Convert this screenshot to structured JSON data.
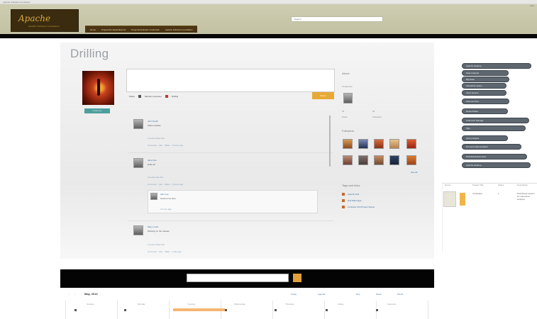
{
  "page": {
    "title": "Drilling"
  },
  "header": {
    "logo": {
      "word": "Apache",
      "sub": "Apache Software Foundation"
    },
    "search_placeholder": "Search",
    "nav": [
      "Home",
      "Projects/Incubator/Events",
      "Projects/Incubator Codes/Lab",
      "Apache Software Foundation"
    ],
    "right": "Help"
  },
  "profile": {
    "button": "Following"
  },
  "status": {
    "actions": [
      "Share",
      "Mention someone",
      "Drilling"
    ],
    "share_button": "Share"
  },
  "feed": {
    "posts": [
      {
        "name": "John Smith",
        "text": "Status update",
        "meta": "Comment · Like · Share · 3 hours ago",
        "likes": "1 person likes this"
      },
      {
        "name": "Jane Doe",
        "text": "Hello all",
        "meta": "Comment · Like · Share · 5 hours ago",
        "likes": "2 people like this",
        "reply_name": "Alex Lee",
        "reply_text": "Great to be here",
        "reply_meta": "2 hours ago"
      },
      {
        "name": "Mary Lewis",
        "text": "Working on the release",
        "meta": "Comment · Like · Share · 1 day ago",
        "likes": "1 person likes this"
      }
    ]
  },
  "sidebar": {
    "about": "About",
    "created": "Created by",
    "stats": [
      {
        "label": "Posts",
        "value": "34"
      },
      {
        "label": "Followers",
        "value": "62"
      }
    ],
    "followers_title": "Followers",
    "see_all": "See All",
    "links_title": "Tags and links",
    "links": [
      "Apache Drill",
      "Drill Wiki Page",
      "Incubator Drill Project Status"
    ]
  },
  "tags": [
    "Apache Hadoop",
    "Data Analysis",
    "Big Data",
    "Interactive Query",
    "Open Source",
    "Schema Free",
    "Nested Data",
    "Columnar Storage",
    "SQL",
    "Query Engine",
    "Dremel Implementation",
    "Distributed Execution"
  ],
  "side_table": {
    "headers": [
      "Name",
      "Project Title",
      "Status",
      "Description"
    ],
    "row": [
      "Apache Drill",
      "Incubating",
      "1",
      "Distributed system for interactive analysis"
    ]
  },
  "calendar": {
    "title": "May, 2013",
    "links": [
      "Today",
      "Agenda",
      "Day",
      "Week",
      "Month"
    ],
    "days": [
      "Sunday",
      "Monday",
      "Tuesday",
      "Wednesday",
      "Thursday",
      "Friday",
      "Saturday"
    ]
  },
  "colors": {
    "header": "#c9c7aa",
    "nav": "#4a3514",
    "accent": "#e7a935",
    "tag_pill": "#5e6770"
  }
}
